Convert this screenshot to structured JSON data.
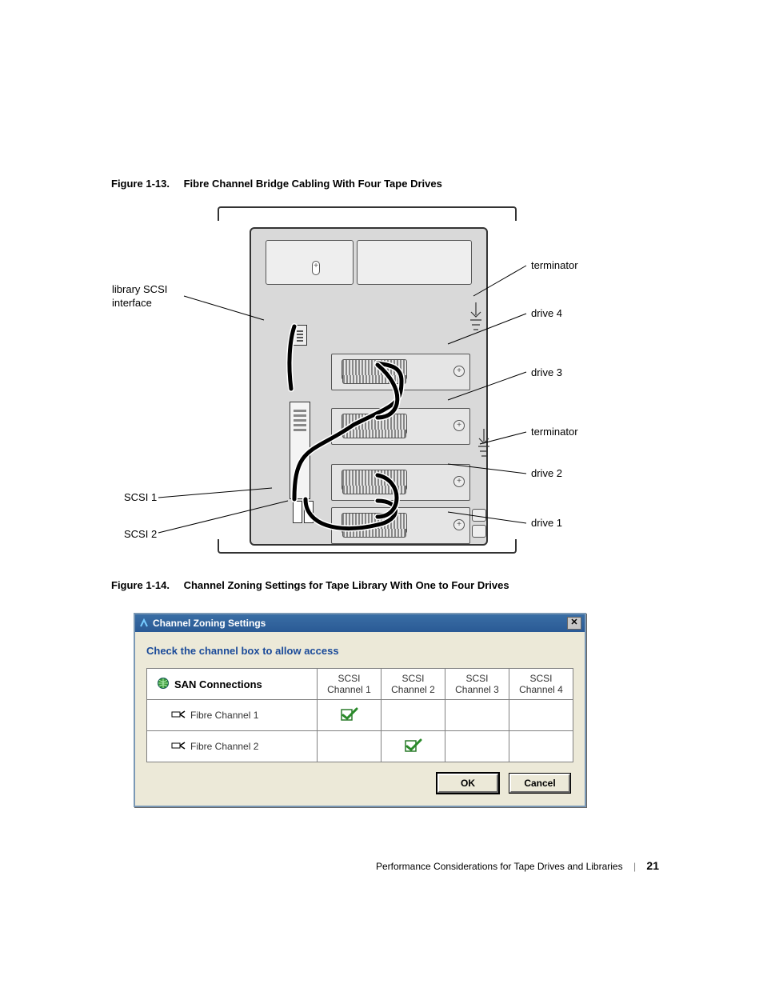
{
  "figure13": {
    "label": "Figure 1-13.",
    "title": "Fibre Channel Bridge Cabling With Four Tape Drives",
    "callouts": {
      "library_scsi": "library SCSI\ninterface",
      "scsi1": "SCSI 1",
      "scsi2": "SCSI 2",
      "terminator_top": "terminator",
      "drive4": "drive 4",
      "drive3": "drive 3",
      "terminator_mid": "terminator",
      "drive2": "drive 2",
      "drive1": "drive 1"
    }
  },
  "figure14": {
    "label": "Figure 1-14.",
    "title": "Channel Zoning Settings for Tape Library With One to Four Drives"
  },
  "dialog": {
    "title": "Channel Zoning Settings",
    "instruction": "Check the channel box to allow access",
    "row_header": "SAN Connections",
    "columns": [
      {
        "line1": "SCSI",
        "line2": "Channel 1"
      },
      {
        "line1": "SCSI",
        "line2": "Channel 2"
      },
      {
        "line1": "SCSI",
        "line2": "Channel 3"
      },
      {
        "line1": "SCSI",
        "line2": "Channel 4"
      }
    ],
    "rows": [
      {
        "label": "Fibre Channel 1",
        "checked_col": 0
      },
      {
        "label": "Fibre Channel 2",
        "checked_col": 1
      }
    ],
    "ok": "OK",
    "cancel": "Cancel"
  },
  "footer": {
    "text": "Performance Considerations for Tape Drives and Libraries",
    "page": "21"
  }
}
